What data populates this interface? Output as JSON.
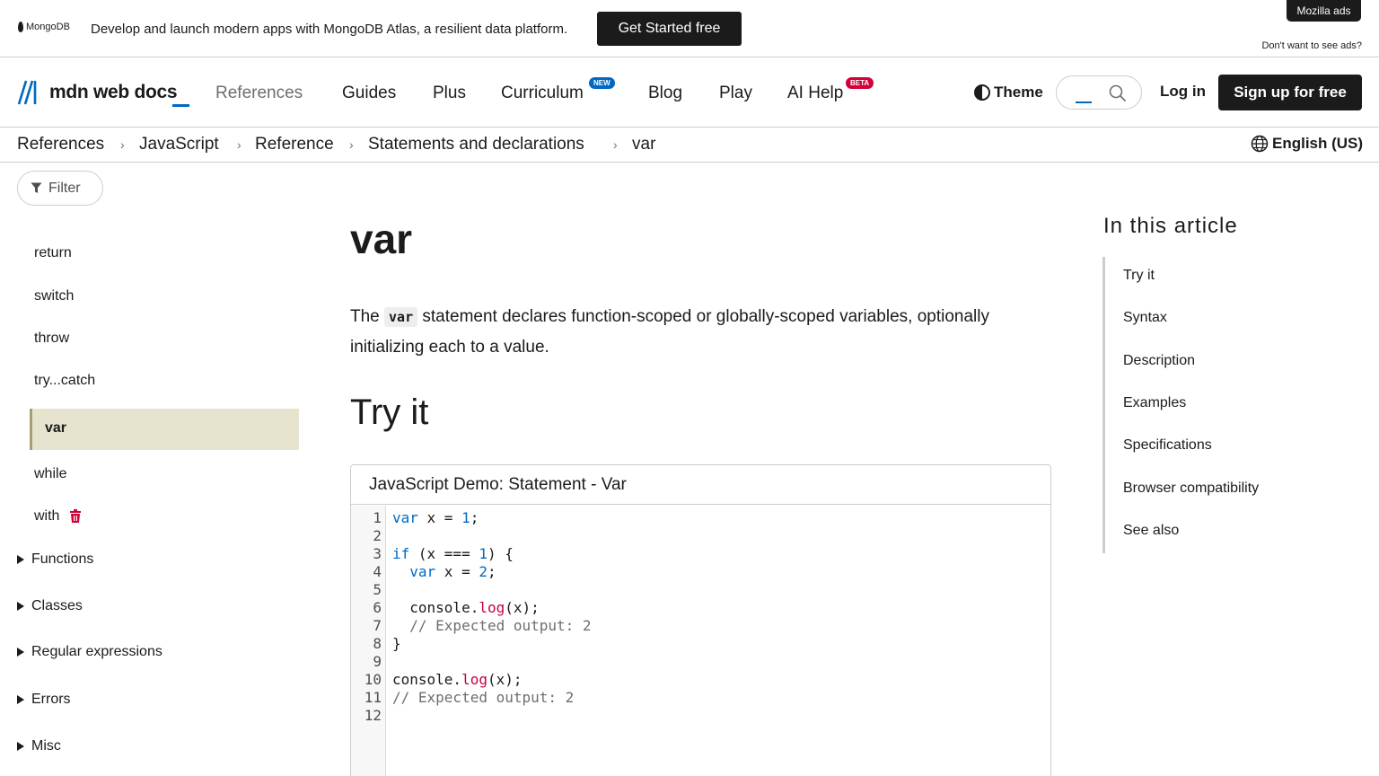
{
  "ad": {
    "brand": "MongoDB",
    "text": "Develop and launch modern apps with MongoDB Atlas, a resilient data platform.",
    "cta": "Get Started free",
    "badge": "Mozilla ads",
    "no_ads": "Don't want to see ads?"
  },
  "header": {
    "logo_text": "mdn web docs",
    "nav": [
      "References",
      "Guides",
      "Plus",
      "Curriculum",
      "Blog",
      "Play",
      "AI Help"
    ],
    "tag_new": "NEW",
    "tag_beta": "BETA",
    "theme": "Theme",
    "login": "Log in",
    "signup": "Sign up for free"
  },
  "breadcrumbs": [
    "References",
    "JavaScript",
    "Reference",
    "Statements and declarations",
    "var"
  ],
  "language": "English (US)",
  "sidebar": {
    "filter": "Filter",
    "items": [
      "return",
      "switch",
      "throw",
      "try...catch",
      "var",
      "while",
      "with"
    ],
    "groups": [
      "Functions",
      "Classes",
      "Regular expressions",
      "Errors",
      "Misc"
    ]
  },
  "main": {
    "title": "var",
    "intro_pre": "The",
    "intro_code": "var",
    "intro_post": "statement declares function-scoped or globally-scoped variables, optionally initializing each to a value.",
    "try_heading": "Try it",
    "demo_title": "JavaScript Demo: Statement - Var",
    "line_numbers": [
      "1",
      "2",
      "3",
      "4",
      "5",
      "6",
      "7",
      "8",
      "9",
      "10",
      "11",
      "12"
    ]
  },
  "toc": {
    "title": "In this article",
    "items": [
      "Try it",
      "Syntax",
      "Description",
      "Examples",
      "Specifications",
      "Browser compatibility",
      "See also"
    ]
  },
  "colors": {
    "accent": "#0069c2",
    "active_bg": "#e6e4cf",
    "beta": "#d30038"
  }
}
